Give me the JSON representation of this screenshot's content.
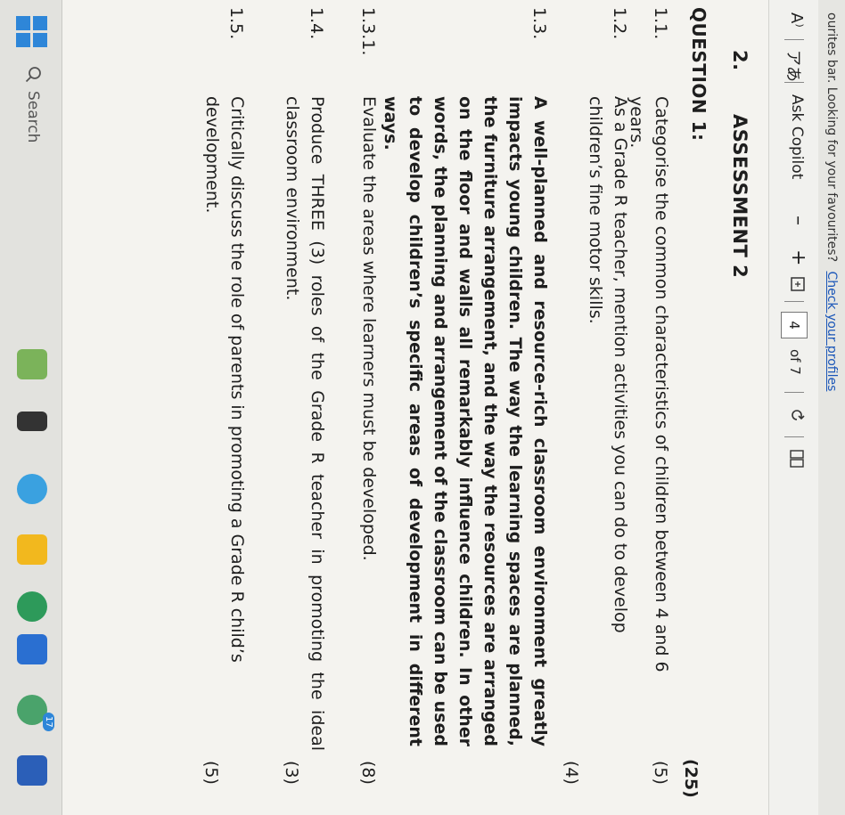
{
  "favourites_bar": {
    "text": "ourites bar. Looking for your favourites?",
    "link": "Check your profiles"
  },
  "toolbar": {
    "read_aloud_icon": "A⁾",
    "translate_icon": "アあ",
    "copilot_label": "Ask Copilot",
    "zoom_out": "–",
    "zoom_in": "+",
    "page_current": "4",
    "page_total": "of 7"
  },
  "document": {
    "section_number": "2.",
    "section_title": "ASSESSMENT 2",
    "question_title": "QUESTION 1:",
    "question_total": "(25)",
    "items": [
      {
        "num": "1.1.",
        "text": "Categorise the common characteristics of children between 4 and 6 years.",
        "marks": "(5)"
      },
      {
        "num": "1.2.",
        "text": "As a Grade R teacher, mention activities you can do to develop children’s fine motor skills.",
        "marks": "(4)"
      },
      {
        "num": "1.3.",
        "text": "A well-planned and resource-rich classroom environment greatly impacts young children. The way the learning spaces are planned, the furniture arrangement, and the way the resources are arranged on the floor and walls all remarkably influence children. In other words, the planning and arrangement of the classroom can be used to develop children’s specific areas of development in different ways.",
        "marks": ""
      },
      {
        "num": "1.3.1.",
        "text": "Evaluate the areas where learners must be developed.",
        "marks": "(8)"
      },
      {
        "num": "1.4.",
        "text": "Produce THREE (3) roles of the Grade R teacher in promoting the ideal classroom environment.",
        "marks": "(3)"
      },
      {
        "num": "1.5.",
        "text": "Critically discuss the role of parents in promoting a Grade R child’s development.",
        "marks": "(5)"
      }
    ]
  },
  "taskbar": {
    "search_label": "Search",
    "badge": "17"
  },
  "colors": {
    "link": "#1a56b8",
    "windows_blue": "#2e86d8"
  }
}
